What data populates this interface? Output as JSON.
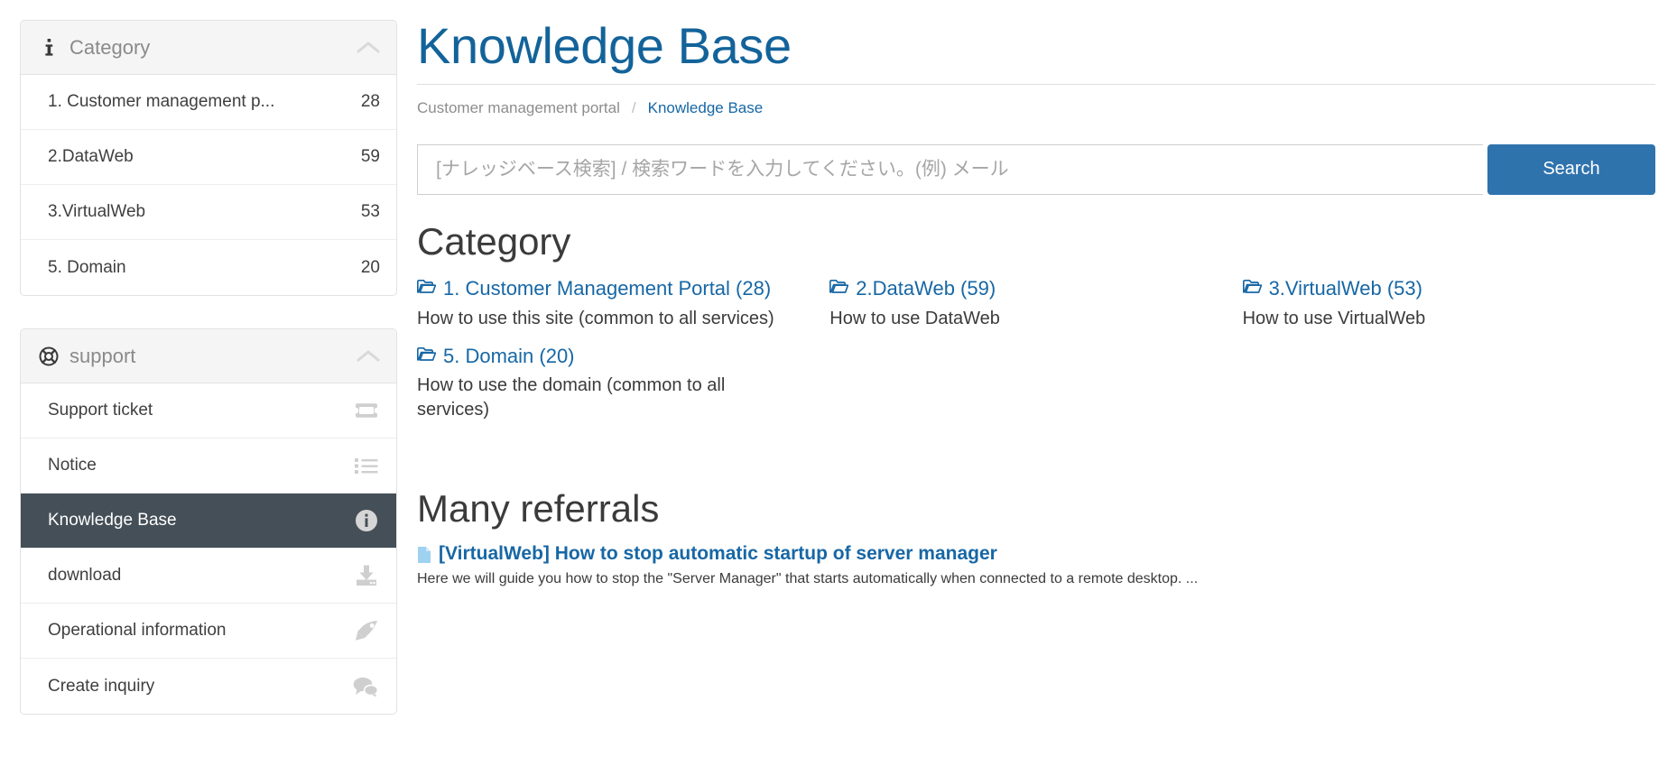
{
  "colors": {
    "title_blue": "#13639a",
    "link_blue": "#1767a5",
    "button_blue": "#2f73ad",
    "active_slate": "#454f57",
    "panel_head_bg": "#f5f5f5",
    "muted_text": "#8d8d8d"
  },
  "sidebar": {
    "category_panel": {
      "icon": "info-icon",
      "title": "Category",
      "collapse_icon": "chevron-up-icon",
      "items": [
        {
          "label": "1. Customer management p...",
          "count": "28"
        },
        {
          "label": "2.DataWeb",
          "count": "59"
        },
        {
          "label": "3.VirtualWeb",
          "count": "53"
        },
        {
          "label": "5. Domain",
          "count": "20"
        }
      ]
    },
    "support_panel": {
      "icon": "life-ring-icon",
      "title": "support",
      "collapse_icon": "chevron-up-icon",
      "items": [
        {
          "label": "Support ticket",
          "icon": "ticket-icon",
          "active": false
        },
        {
          "label": "Notice",
          "icon": "list-ul-icon",
          "active": false
        },
        {
          "label": "Knowledge Base",
          "icon": "info-circle-icon",
          "active": true
        },
        {
          "label": "download",
          "icon": "download-icon",
          "active": false
        },
        {
          "label": "Operational information",
          "icon": "rocket-icon",
          "active": false
        },
        {
          "label": "Create inquiry",
          "icon": "comments-icon",
          "active": false
        }
      ]
    }
  },
  "header": {
    "title": "Knowledge Base",
    "breadcrumb": {
      "root": "Customer management portal",
      "separator": "/",
      "current": "Knowledge Base"
    }
  },
  "search": {
    "placeholder": "[ナレッジベース検索] / 検索ワードを入力してください。(例) メール",
    "value": "",
    "button_label": "Search"
  },
  "category_section": {
    "heading": "Category",
    "items": [
      {
        "icon": "folder-open-icon",
        "link": "1. Customer Management Portal (28)",
        "description": "How to use this site (common to all services)"
      },
      {
        "icon": "folder-open-icon",
        "link": "2.DataWeb (59)",
        "description": "How to use DataWeb"
      },
      {
        "icon": "folder-open-icon",
        "link": "3.VirtualWeb (53)",
        "description": "How to use VirtualWeb"
      },
      {
        "icon": "folder-open-icon",
        "link": "5. Domain (20)",
        "description": "How to use the domain (common to all services)"
      }
    ]
  },
  "referrals_section": {
    "heading": "Many referrals",
    "items": [
      {
        "icon": "file-icon",
        "link": "[VirtualWeb] How to stop automatic startup of server manager",
        "description": "Here we will guide you how to stop the \"Server Manager\" that starts automatically when connected to a remote desktop. ..."
      }
    ]
  }
}
